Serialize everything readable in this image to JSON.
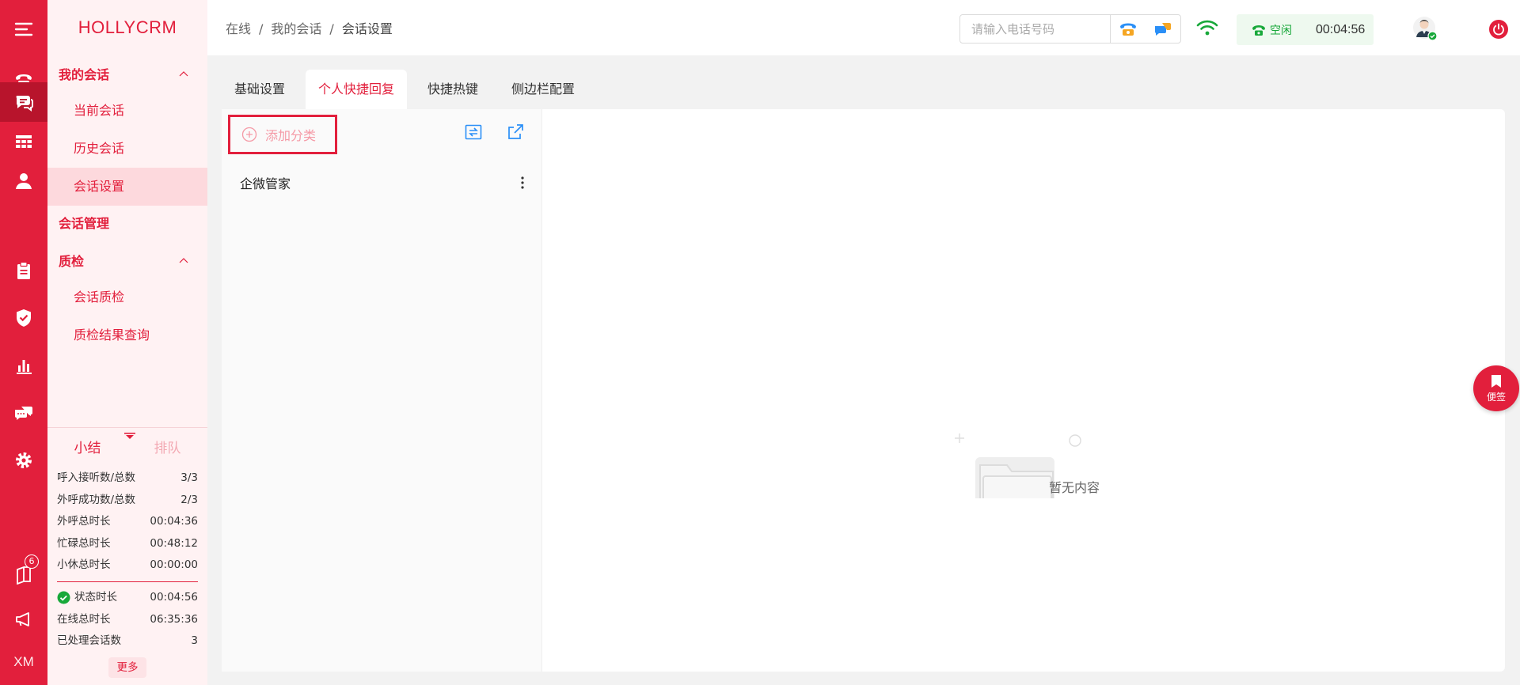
{
  "app": {
    "logo": "HOLLYCRM"
  },
  "rail": {
    "items": [
      {
        "icon": "menu-icon"
      },
      {
        "icon": "phone-icon"
      },
      {
        "icon": "chat-icon",
        "active": true
      },
      {
        "icon": "grid-icon"
      },
      {
        "icon": "user-icon"
      },
      {
        "icon": "clipboard-icon"
      },
      {
        "icon": "shield-icon"
      },
      {
        "icon": "bar-chart-icon"
      },
      {
        "icon": "message-icon"
      },
      {
        "icon": "settings-icon"
      },
      {
        "icon": "book-icon",
        "badge": "6"
      },
      {
        "icon": "megaphone-icon"
      }
    ],
    "xm_label": "XM"
  },
  "sidebar": {
    "groups": {
      "my_sessions": "我的会话",
      "session_mgmt": "会话管理",
      "quality": "质检"
    },
    "items": {
      "current": "当前会话",
      "history": "历史会话",
      "settings": "会话设置",
      "qc": "会话质检",
      "qc_results": "质检结果查询"
    },
    "stats": {
      "tab_summary": "小结",
      "tab_queue": "排队",
      "rows": [
        {
          "label": "呼入接听数/总数",
          "value": "3/3"
        },
        {
          "label": "外呼成功数/总数",
          "value": "2/3"
        },
        {
          "label": "外呼总时长",
          "value": "00:04:36"
        },
        {
          "label": "忙碌总时长",
          "value": "00:48:12"
        },
        {
          "label": "小休总时长",
          "value": "00:00:00"
        }
      ],
      "rows2": [
        {
          "label": "状态时长",
          "value": "00:04:56"
        },
        {
          "label": "在线总时长",
          "value": "06:35:36"
        },
        {
          "label": "已处理会话数",
          "value": "3"
        }
      ],
      "more": "更多"
    }
  },
  "header": {
    "breadcrumb": [
      "在线",
      "我的会话",
      "会话设置"
    ],
    "phone_placeholder": "请输入电话号码",
    "status": "空闲",
    "status_time": "00:04:56"
  },
  "tabs": [
    "基础设置",
    "个人快捷回复",
    "快捷热键",
    "侧边栏配置"
  ],
  "panel": {
    "add_category": "添加分类",
    "categories": [
      "企微管家"
    ],
    "empty_text": "暂无内容"
  },
  "float_note": "便签",
  "colors": {
    "primary": "#e21f3c",
    "success": "#18a83a",
    "link": "#2a8ff7"
  }
}
